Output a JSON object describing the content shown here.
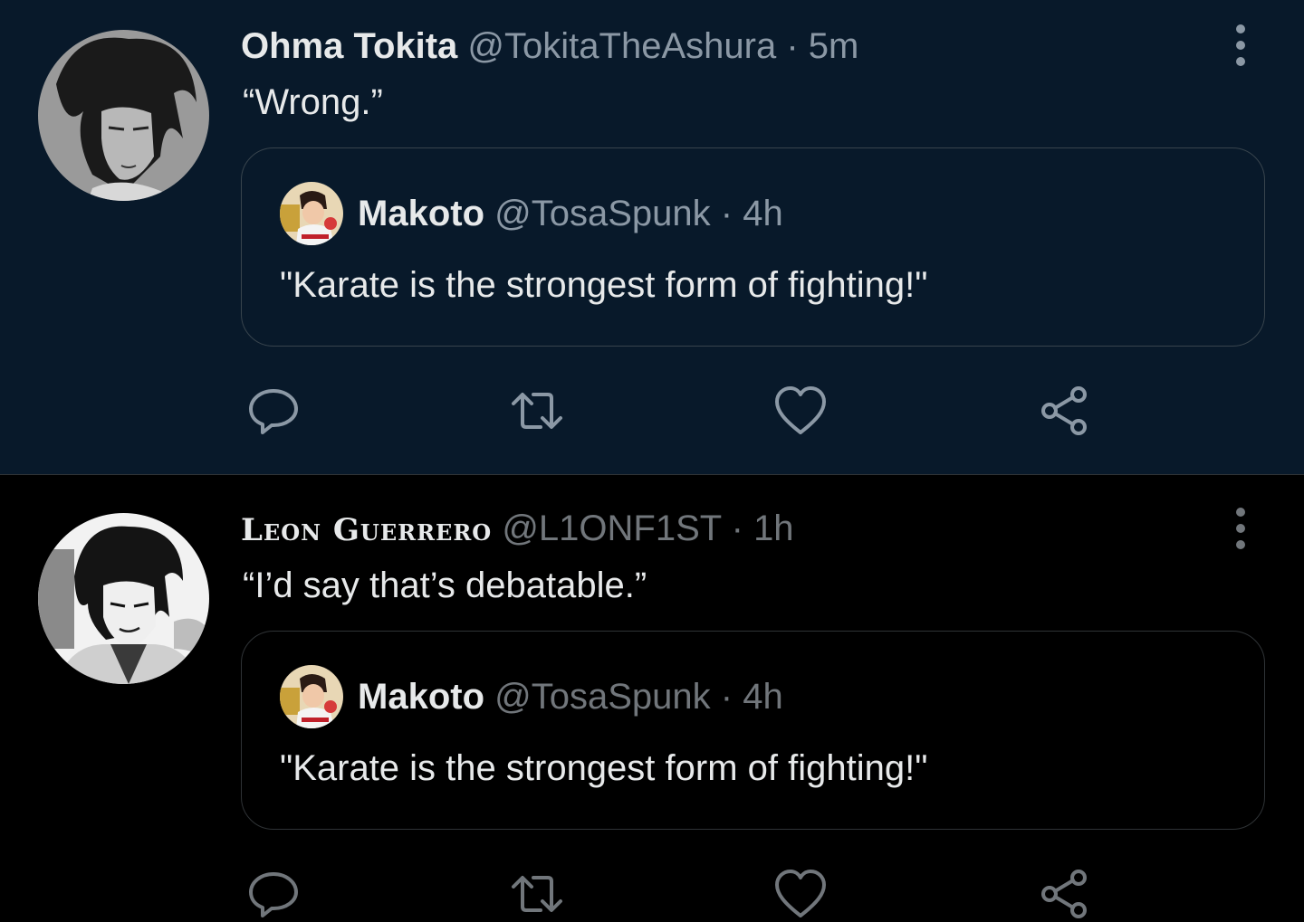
{
  "tweets": [
    {
      "display_name": "Ohma Tokita",
      "handle": "@TokitaTheAshura",
      "separator": "·",
      "time": "5m",
      "text": "“Wrong.”",
      "quote": {
        "display_name": "Makoto",
        "handle": "@TosaSpunk",
        "separator": "·",
        "time": "4h",
        "text": "\"Karate is the strongest form of fighting!\""
      }
    },
    {
      "display_name": "Leon Guerrero",
      "handle": "@L1ONF1ST",
      "separator": "·",
      "time": "1h",
      "text": "“I’d say that’s debatable.”",
      "quote": {
        "display_name": "Makoto",
        "handle": "@TosaSpunk",
        "separator": "·",
        "time": "4h",
        "text": "\"Karate is the strongest form of fighting!\""
      }
    }
  ],
  "icons": {
    "reply": "reply-icon",
    "retweet": "retweet-icon",
    "like": "heart-icon",
    "share": "share-icon",
    "more": "more-vertical-icon"
  },
  "colors": {
    "tweet_1_background": "#08192a",
    "tweet_2_background": "#000000",
    "primary_text": "#e7e9ea",
    "secondary_text": "#8b98a5"
  }
}
